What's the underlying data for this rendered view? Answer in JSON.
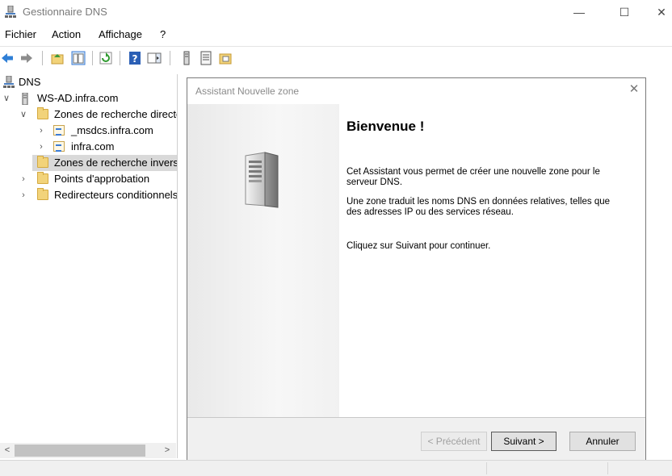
{
  "window": {
    "title": "Gestionnaire DNS",
    "minimize_glyph": "—",
    "maximize_glyph": "☐",
    "close_glyph": "✕"
  },
  "menu": [
    "Fichier",
    "Action",
    "Affichage",
    "?"
  ],
  "toolbar_icons": [
    "back-arrow-icon",
    "forward-arrow-icon",
    "up-folder-icon",
    "show-hide-tree-icon",
    "refresh-icon",
    "help-icon",
    "action-pane-icon",
    "server-icon",
    "list-icon",
    "folder-icon"
  ],
  "tree": {
    "root": "DNS",
    "server": "WS-AD.infra.com",
    "forward_zones": "Zones de recherche directe",
    "zone_msdcs": "_msdcs.infra.com",
    "zone_infra": "infra.com",
    "reverse_zones": "Zones de recherche inversée",
    "trust_points": "Points d'approbation",
    "conditional_forwarders": "Redirecteurs conditionnels"
  },
  "dialog": {
    "title": "Assistant Nouvelle zone",
    "heading": "Bienvenue !",
    "para1": "Cet Assistant vous permet de créer une nouvelle zone pour le serveur DNS.",
    "para2": "Une zone traduit les noms DNS en données relatives, telles que des adresses IP ou des services réseau.",
    "para3": "Cliquez sur Suivant pour continuer.",
    "buttons": {
      "previous": "< Précédent",
      "next": "Suivant >",
      "cancel": "Annuler"
    }
  },
  "scroll_glyphs": {
    "left": "<",
    "right": ">"
  }
}
